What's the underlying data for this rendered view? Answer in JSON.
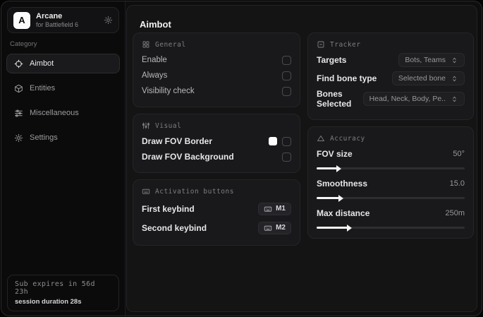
{
  "app": {
    "name": "Arcane",
    "subtitle": "for Battlefield 6",
    "logo_letter": "A"
  },
  "sidebar": {
    "category_label": "Category",
    "items": [
      {
        "label": "Aimbot",
        "icon": "crosshair-icon",
        "active": true
      },
      {
        "label": "Entities",
        "icon": "box-icon",
        "active": false
      },
      {
        "label": "Miscellaneous",
        "icon": "sliders-icon",
        "active": false
      },
      {
        "label": "Settings",
        "icon": "gear-icon",
        "active": false
      }
    ],
    "footer": {
      "sub_expiry": "Sub expires in 56d 23h",
      "session_duration": "session duration 28s"
    }
  },
  "main": {
    "title": "Aimbot",
    "general": {
      "title": "General",
      "rows": [
        {
          "label": "Enable",
          "checked": false
        },
        {
          "label": "Always",
          "checked": false
        },
        {
          "label": "Visibility check",
          "checked": false
        }
      ]
    },
    "visual": {
      "title": "Visual",
      "rows": [
        {
          "label": "Draw FOV Border",
          "swatch_color": "#ffffff",
          "checked": false
        },
        {
          "label": "Draw FOV Background",
          "checked": false
        }
      ]
    },
    "activation": {
      "title": "Activation buttons",
      "rows": [
        {
          "label": "First keybind",
          "key": "M1"
        },
        {
          "label": "Second keybind",
          "key": "M2"
        }
      ]
    },
    "tracker": {
      "title": "Tracker",
      "rows": [
        {
          "label": "Targets",
          "value": "Bots, Teams"
        },
        {
          "label": "Find bone type",
          "value": "Selected bone"
        },
        {
          "label": "Bones Selected",
          "value": "Head, Neck, Body, Pe.."
        }
      ]
    },
    "accuracy": {
      "title": "Accuracy",
      "sliders": [
        {
          "label": "FOV size",
          "value": "50°",
          "fill_percent": 14
        },
        {
          "label": "Smoothness",
          "value": "15.0",
          "fill_percent": 15
        },
        {
          "label": "Max distance",
          "value": "250m",
          "fill_percent": 21
        }
      ]
    }
  },
  "colors": {
    "accent": "#ffffff",
    "sidebar_bg": "#0b0b0c",
    "panel_bg": "#141415",
    "card_bg": "#19191b",
    "card_border": "#252528"
  }
}
